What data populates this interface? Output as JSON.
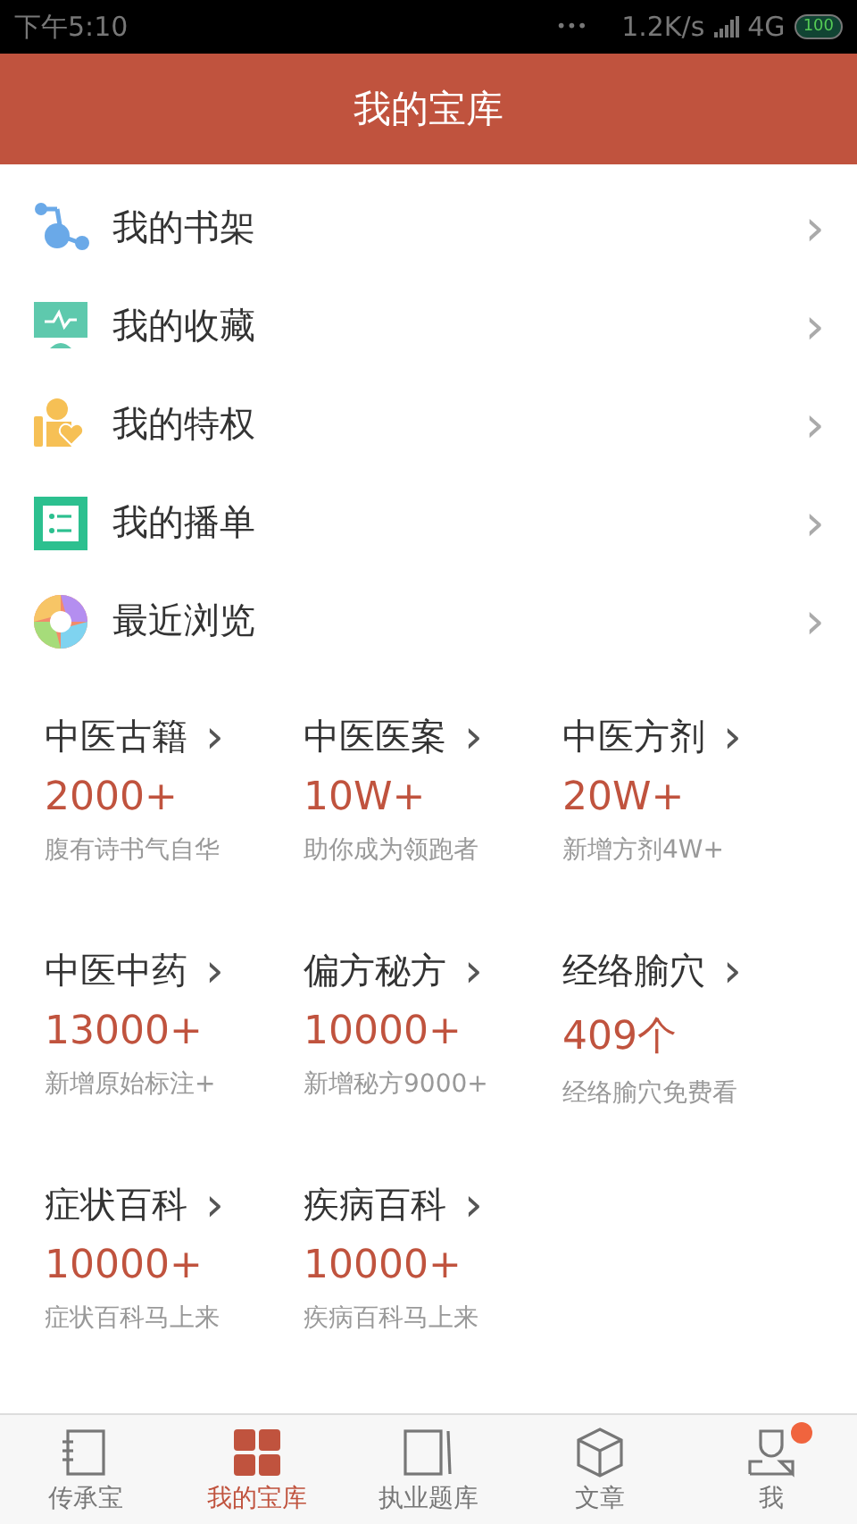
{
  "status_bar": {
    "time": "下午5:10",
    "dots": "•••",
    "speed": "1.2K/s",
    "network": "4G",
    "battery": "100"
  },
  "header": {
    "title": "我的宝库"
  },
  "menu": [
    {
      "label": "我的书架",
      "arrow": "›"
    },
    {
      "label": "我的收藏",
      "arrow": "›"
    },
    {
      "label": "我的特权",
      "arrow": "›"
    },
    {
      "label": "我的播单",
      "arrow": "›"
    },
    {
      "label": "最近浏览",
      "arrow": "›"
    }
  ],
  "categories": [
    {
      "title": "中医古籍",
      "arrow": "›",
      "count": "2000+",
      "note": "腹有诗书气自华"
    },
    {
      "title": "中医医案",
      "arrow": "›",
      "count": "10W+",
      "note": "助你成为领跑者"
    },
    {
      "title": "中医方剂",
      "arrow": "›",
      "count": "20W+",
      "note": "新增方剂4W+"
    },
    {
      "title": "中医中药",
      "arrow": "›",
      "count": "13000+",
      "note": "新增原始标注+"
    },
    {
      "title": "偏方秘方",
      "arrow": "›",
      "count": "10000+",
      "note": "新增秘方9000+"
    },
    {
      "title": "经络腧穴",
      "arrow": "›",
      "count": "409个",
      "note": "经络腧穴免费看"
    },
    {
      "title": "症状百科",
      "arrow": "›",
      "count": "10000+",
      "note": "症状百科马上来"
    },
    {
      "title": "疾病百科",
      "arrow": "›",
      "count": "10000+",
      "note": "疾病百科马上来"
    }
  ],
  "tabs": [
    {
      "label": "传承宝",
      "selected": false,
      "badge": false
    },
    {
      "label": "我的宝库",
      "selected": true,
      "badge": false
    },
    {
      "label": "执业题库",
      "selected": false,
      "badge": false
    },
    {
      "label": "文章",
      "selected": false,
      "badge": false
    },
    {
      "label": "我",
      "selected": false,
      "badge": true
    }
  ]
}
